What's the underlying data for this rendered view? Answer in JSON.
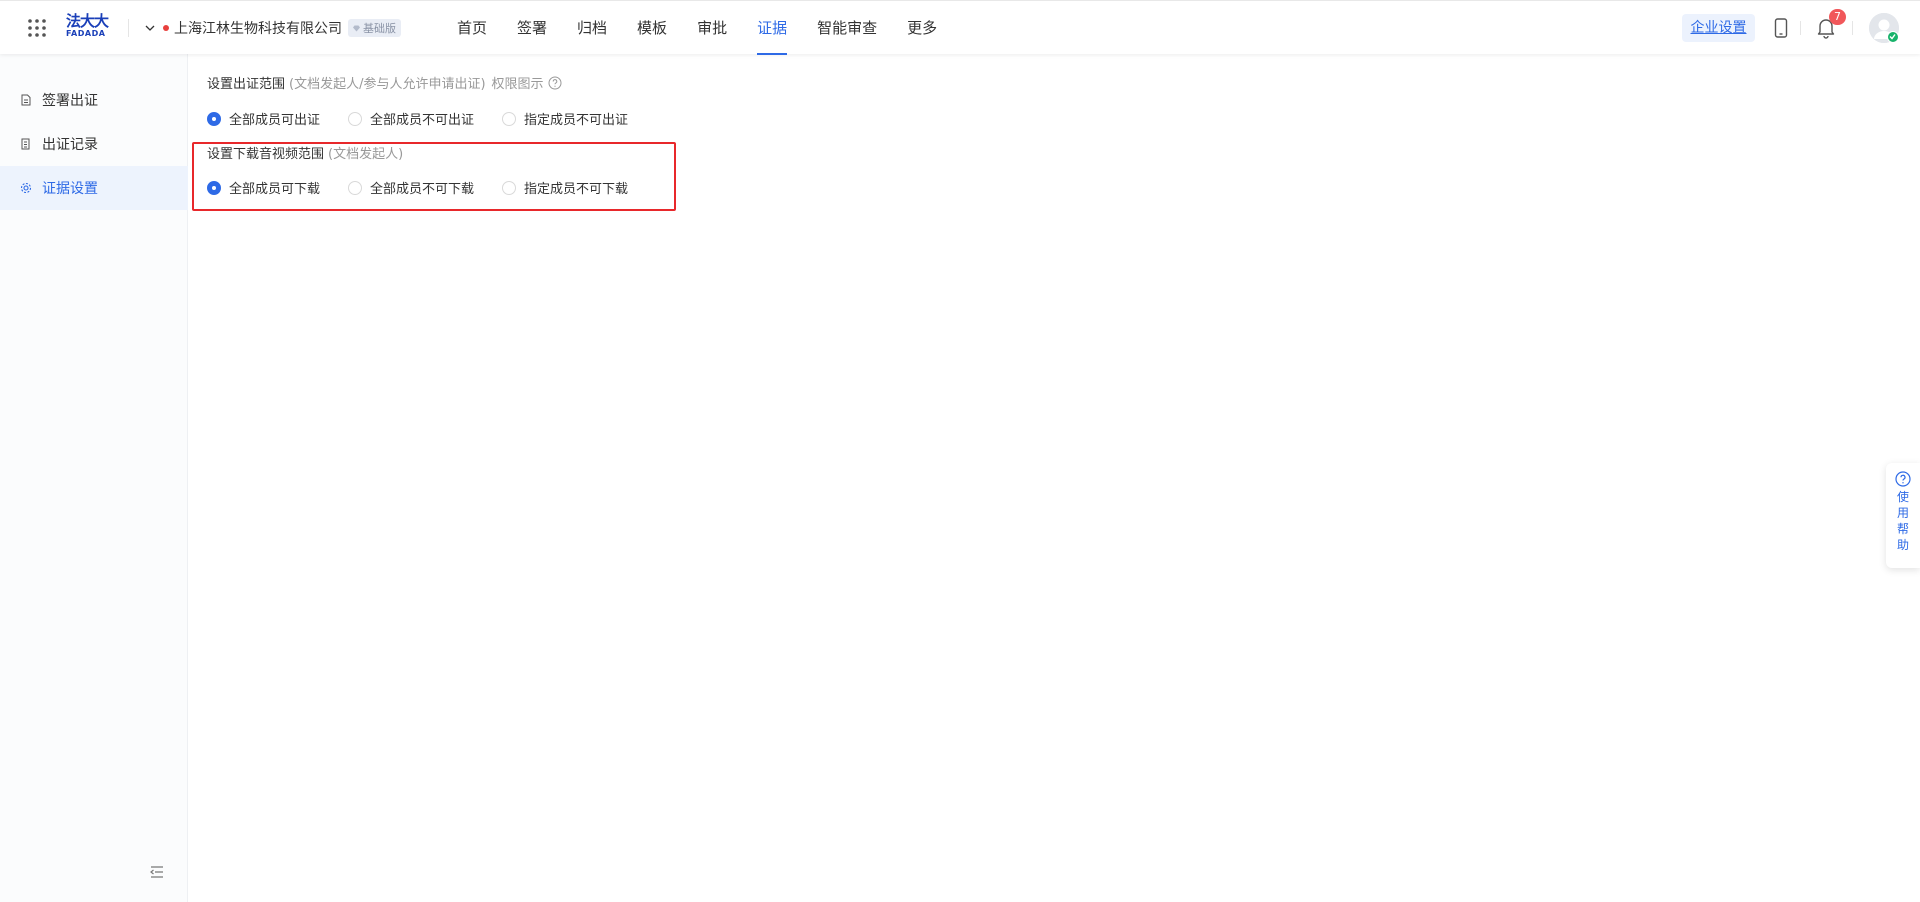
{
  "header": {
    "logo_cn": "法大大",
    "logo_en": "FADADA",
    "company_name": "上海江林生物科技有限公司",
    "edition_badge": "基础版",
    "nav": [
      {
        "label": "首页",
        "active": false
      },
      {
        "label": "签署",
        "active": false
      },
      {
        "label": "归档",
        "active": false
      },
      {
        "label": "模板",
        "active": false
      },
      {
        "label": "审批",
        "active": false
      },
      {
        "label": "证据",
        "active": true
      },
      {
        "label": "智能审查",
        "active": false
      },
      {
        "label": "更多",
        "active": false
      }
    ],
    "enterprise_settings": "企业设置",
    "notification_count": "7"
  },
  "sidebar": {
    "items": [
      {
        "label": "签署出证",
        "icon": "document-icon",
        "active": false
      },
      {
        "label": "出证记录",
        "icon": "records-icon",
        "active": false
      },
      {
        "label": "证据设置",
        "icon": "gear-icon",
        "active": true
      }
    ]
  },
  "main": {
    "issue_scope": {
      "title": "设置出证范围",
      "hint": "(文档发起人/参与人允许申请出证)",
      "permission_link": "权限图示",
      "options": [
        "全部成员可出证",
        "全部成员不可出证",
        "指定成员不可出证"
      ],
      "selected": 0
    },
    "download_scope": {
      "title": "设置下载音视频范围",
      "hint": "(文档发起人)",
      "options": [
        "全部成员可下载",
        "全部成员不可下载",
        "指定成员不可下载"
      ],
      "selected": 0
    }
  },
  "help": {
    "label": "使用帮助"
  },
  "colors": {
    "accent": "#2e6ae6",
    "highlight": "#e8282b",
    "badge": "#f1575a"
  }
}
